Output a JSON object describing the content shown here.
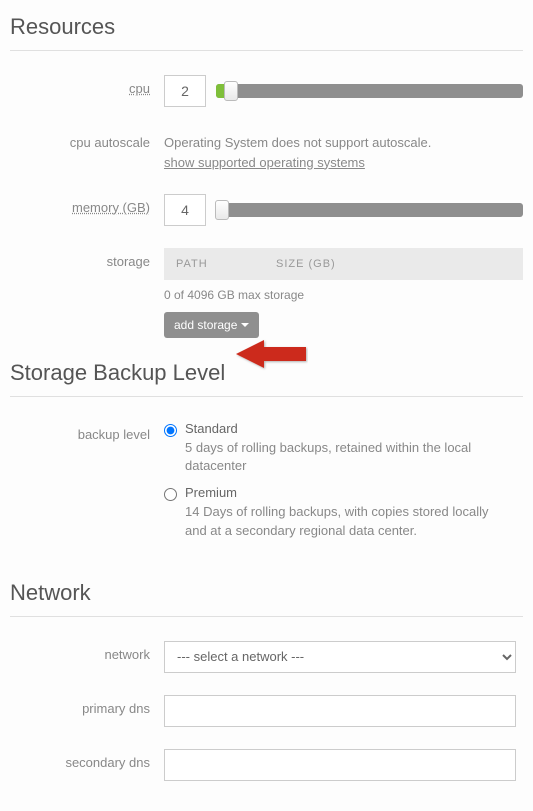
{
  "resources": {
    "heading": "Resources",
    "cpu": {
      "label": "cpu",
      "value": "2",
      "slider_percent": 5
    },
    "cpu_autoscale": {
      "label": "cpu autoscale",
      "note": "Operating System does not support autoscale.",
      "link": "show supported operating systems"
    },
    "memory": {
      "label": "memory (GB)",
      "value": "4",
      "slider_percent": 2
    },
    "storage": {
      "label": "storage",
      "col_path": "PATH",
      "col_size": "SIZE (GB)",
      "note": "0 of 4096 GB max storage",
      "button": "add storage"
    }
  },
  "backup": {
    "heading": "Storage Backup Level",
    "label": "backup level",
    "options": {
      "standard": {
        "name": "Standard",
        "desc": "5 days of rolling backups, retained within the local datacenter"
      },
      "premium": {
        "name": "Premium",
        "desc": "14 Days of rolling backups, with copies stored locally and at a secondary regional data center."
      }
    }
  },
  "network": {
    "heading": "Network",
    "network_label": "network",
    "network_placeholder": "--- select a network ---",
    "primary_dns_label": "primary dns",
    "secondary_dns_label": "secondary dns"
  }
}
